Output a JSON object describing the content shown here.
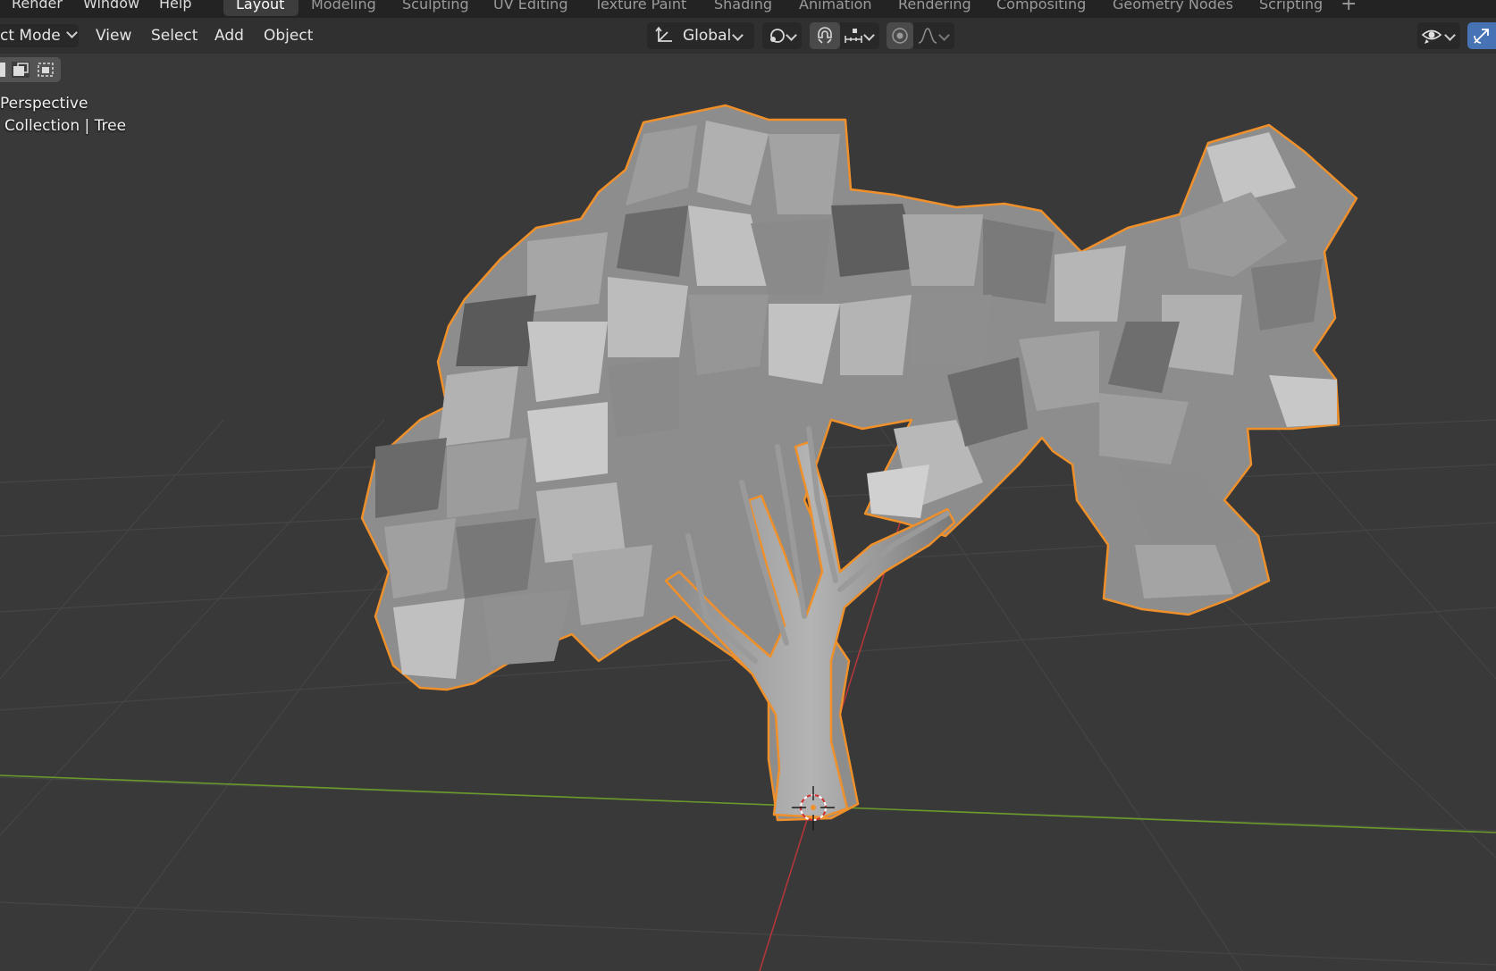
{
  "topbar": {
    "menus": [
      "Render",
      "Window",
      "Help"
    ],
    "workspaces": [
      "Layout",
      "Modeling",
      "Sculpting",
      "UV Editing",
      "Texture Paint",
      "Shading",
      "Animation",
      "Rendering",
      "Compositing",
      "Geometry Nodes",
      "Scripting"
    ],
    "active_workspace": "Layout",
    "add_workspace": "+"
  },
  "header": {
    "mode": "ct Mode",
    "menus": [
      "View",
      "Select",
      "Add",
      "Object"
    ],
    "orientation": "Global"
  },
  "viewport": {
    "view_name": "Perspective",
    "collection_info": "Collection | Tree",
    "object_name": "Tree",
    "selection_outline_color": "#f0902a",
    "x_axis_color": "#b2363a",
    "y_axis_color": "#6a9a2a"
  },
  "colors": {
    "background": "#393939",
    "active_toggle": "#4772b3",
    "header": "#303030"
  }
}
